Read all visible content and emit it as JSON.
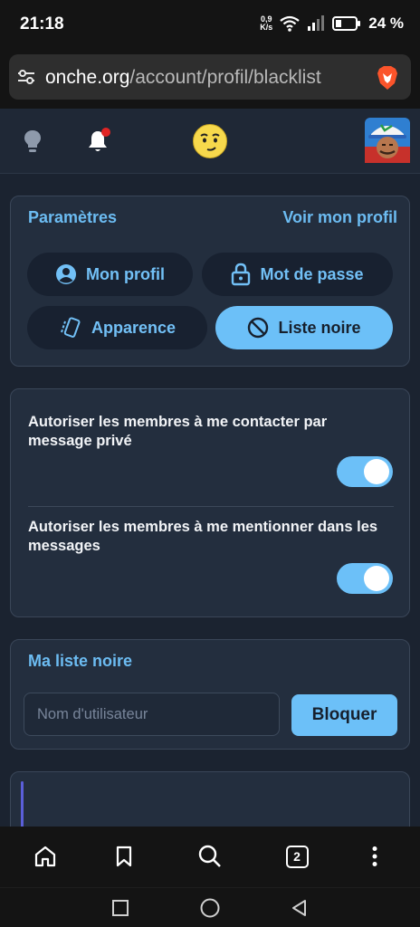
{
  "status_bar": {
    "time": "21:18",
    "net_speed_value": "0,9",
    "net_speed_unit": "K/s",
    "battery": "24 %"
  },
  "browser": {
    "url_domain": "onche.org",
    "url_path": "/account/profil/blacklist",
    "brand_color": "#fb542b"
  },
  "header": {
    "icons": [
      "lightbulb-icon",
      "bell-icon",
      "smiley-logo",
      "avatar"
    ]
  },
  "settings": {
    "title": "Paramètres",
    "view_profile": "Voir mon profil",
    "tabs": [
      {
        "label": "Mon profil",
        "icon": "user-circle-icon",
        "active": false
      },
      {
        "label": "Mot de passe",
        "icon": "lock-icon",
        "active": false
      },
      {
        "label": "Apparence",
        "icon": "phone-tilted-icon",
        "active": false
      },
      {
        "label": "Liste noire",
        "icon": "ban-icon",
        "active": true
      }
    ]
  },
  "privacy": {
    "items": [
      {
        "label": "Autoriser les membres à me contacter par message privé",
        "enabled": true
      },
      {
        "label": "Autoriser les membres à me mentionner dans les messages",
        "enabled": true
      }
    ]
  },
  "blacklist": {
    "title": "Ma liste noire",
    "placeholder": "Nom d'utilisateur",
    "button": "Bloquer"
  },
  "bottom_nav": {
    "tab_count": "2",
    "icons": [
      "home-icon",
      "bookmark-icon",
      "search-icon",
      "tabs-icon",
      "more-icon"
    ]
  },
  "colors": {
    "accent": "#6cc0f8",
    "card": "#232e3e",
    "background": "#1b2330"
  }
}
